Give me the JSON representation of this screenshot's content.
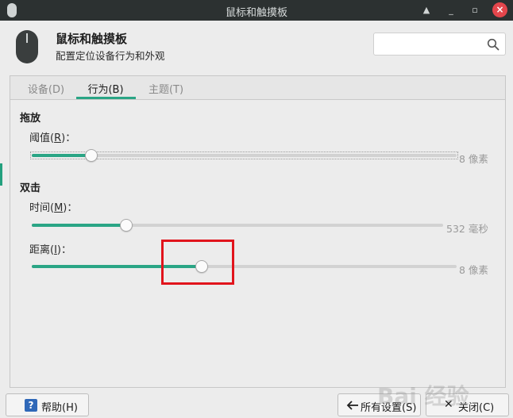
{
  "window": {
    "title": "鼠标和触摸板",
    "controls": {
      "shade_icon": "▲",
      "minimize_icon": "_",
      "maximize_icon": "▫",
      "close_icon": "×"
    }
  },
  "header": {
    "title": "鼠标和触摸板",
    "subtitle": "配置定位设备行为和外观",
    "search": {
      "value": "",
      "placeholder": ""
    }
  },
  "tabs": [
    {
      "label": "设备(D)",
      "active": false
    },
    {
      "label": "行为(B)",
      "active": true
    },
    {
      "label": "主题(T)",
      "active": false
    }
  ],
  "sections": {
    "drag": {
      "title": "拖放",
      "threshold": {
        "label_pre": "阈值(",
        "label_key": "R",
        "label_post": ")：",
        "value_text": "8 像素",
        "fraction": 0.14
      }
    },
    "double_click": {
      "title": "双击",
      "time": {
        "label_pre": "时间(",
        "label_key": "M",
        "label_post": ")：",
        "value_text": "532 毫秒",
        "fraction": 0.23
      },
      "distance": {
        "label_pre": "距离(",
        "label_key": "I",
        "label_post": ")：",
        "value_text": "8 像素",
        "fraction": 0.4
      }
    }
  },
  "footer": {
    "help_label": "帮助(H)",
    "all_settings_label": "所有设置(S)",
    "close_label": "关闭(C)"
  },
  "colors": {
    "accent": "#2aa585",
    "close_button": "#e4464c",
    "highlight": "#e1141c"
  },
  "watermark": "Bai 经验"
}
